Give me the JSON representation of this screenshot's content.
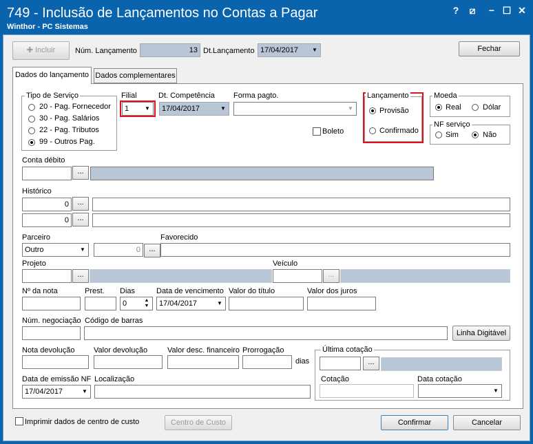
{
  "window": {
    "title": "749 - Inclusão de Lançamentos no Contas a Pagar",
    "subtitle": "Winthor - PC Sistemas",
    "help": "?",
    "restore": "⧄",
    "min": "−",
    "max": "☐",
    "close": "✕"
  },
  "toolbar": {
    "incluir": "Incluir",
    "num_lanc_label": "Núm. Lançamento",
    "num_lanc": "13",
    "dt_lanc_label": "Dt.Lançamento",
    "dt_lanc": "17/04/2017",
    "fechar": "Fechar"
  },
  "tabs": [
    {
      "label": "Dados do lançamento"
    },
    {
      "label": "Dados complementares"
    }
  ],
  "tipo_servico": {
    "label": "Tipo de Serviço",
    "options": [
      "20 - Pag. Fornecedor",
      "30 - Pag. Salários",
      "22 - Pag. Tributos",
      "99 - Outros Pag."
    ],
    "selected": 3
  },
  "filial": {
    "label": "Filial",
    "value": "1"
  },
  "dt_competencia": {
    "label": "Dt. Competência",
    "value": "17/04/2017"
  },
  "forma_pagto": {
    "label": "Forma pagto.",
    "value": ""
  },
  "boleto": {
    "label": "Boleto"
  },
  "lancamento": {
    "label": "Lançamento",
    "options": [
      "Provisão",
      "Confirmado"
    ],
    "selected": 0
  },
  "moeda": {
    "label": "Moeda",
    "options": [
      "Real",
      "Dólar"
    ],
    "selected": 0
  },
  "nf_servico": {
    "label": "NF serviço",
    "options": [
      "Sim",
      "Não"
    ],
    "selected": 1
  },
  "conta_debito": {
    "label": "Conta débito"
  },
  "historico": {
    "label": "Histórico",
    "rows": [
      {
        "code": "0"
      },
      {
        "code": "0"
      }
    ]
  },
  "parceiro": {
    "label": "Parceiro",
    "value": "Outro",
    "code": "0"
  },
  "favorecido": {
    "label": "Favorecido"
  },
  "projeto": {
    "label": "Projeto"
  },
  "veiculo": {
    "label": "Veículo"
  },
  "nota": {
    "num_label": "Nº da nota",
    "prest_label": "Prest.",
    "dias_label": "Dias",
    "dias": "0",
    "venc_label": "Data de vencimento",
    "venc": "17/04/2017",
    "valor_titulo_label": "Valor do título",
    "valor_juros_label": "Valor dos juros"
  },
  "negociacao": {
    "label": "Núm. negociação",
    "barras_label": "Código de barras",
    "linha_digitavel": "Linha Digitável"
  },
  "devolucao": {
    "nota_label": "Nota devolução",
    "valor_label": "Valor devolução",
    "desc_label": "Valor desc. financeiro",
    "prorrog_label": "Prorrogação",
    "dias": "dias"
  },
  "emissao": {
    "label": "Data de emissão NF",
    "value": "17/04/2017",
    "local_label": "Localização"
  },
  "cotacao": {
    "label": "Última cotação",
    "cot_label": "Cotação",
    "data_label": "Data cotação"
  },
  "footer": {
    "imprimir": "Imprimir dados de centro de custo",
    "centro_custo": "Centro de Custo",
    "confirmar": "Confirmar",
    "cancelar": "Cancelar"
  },
  "ellipsis": "..."
}
